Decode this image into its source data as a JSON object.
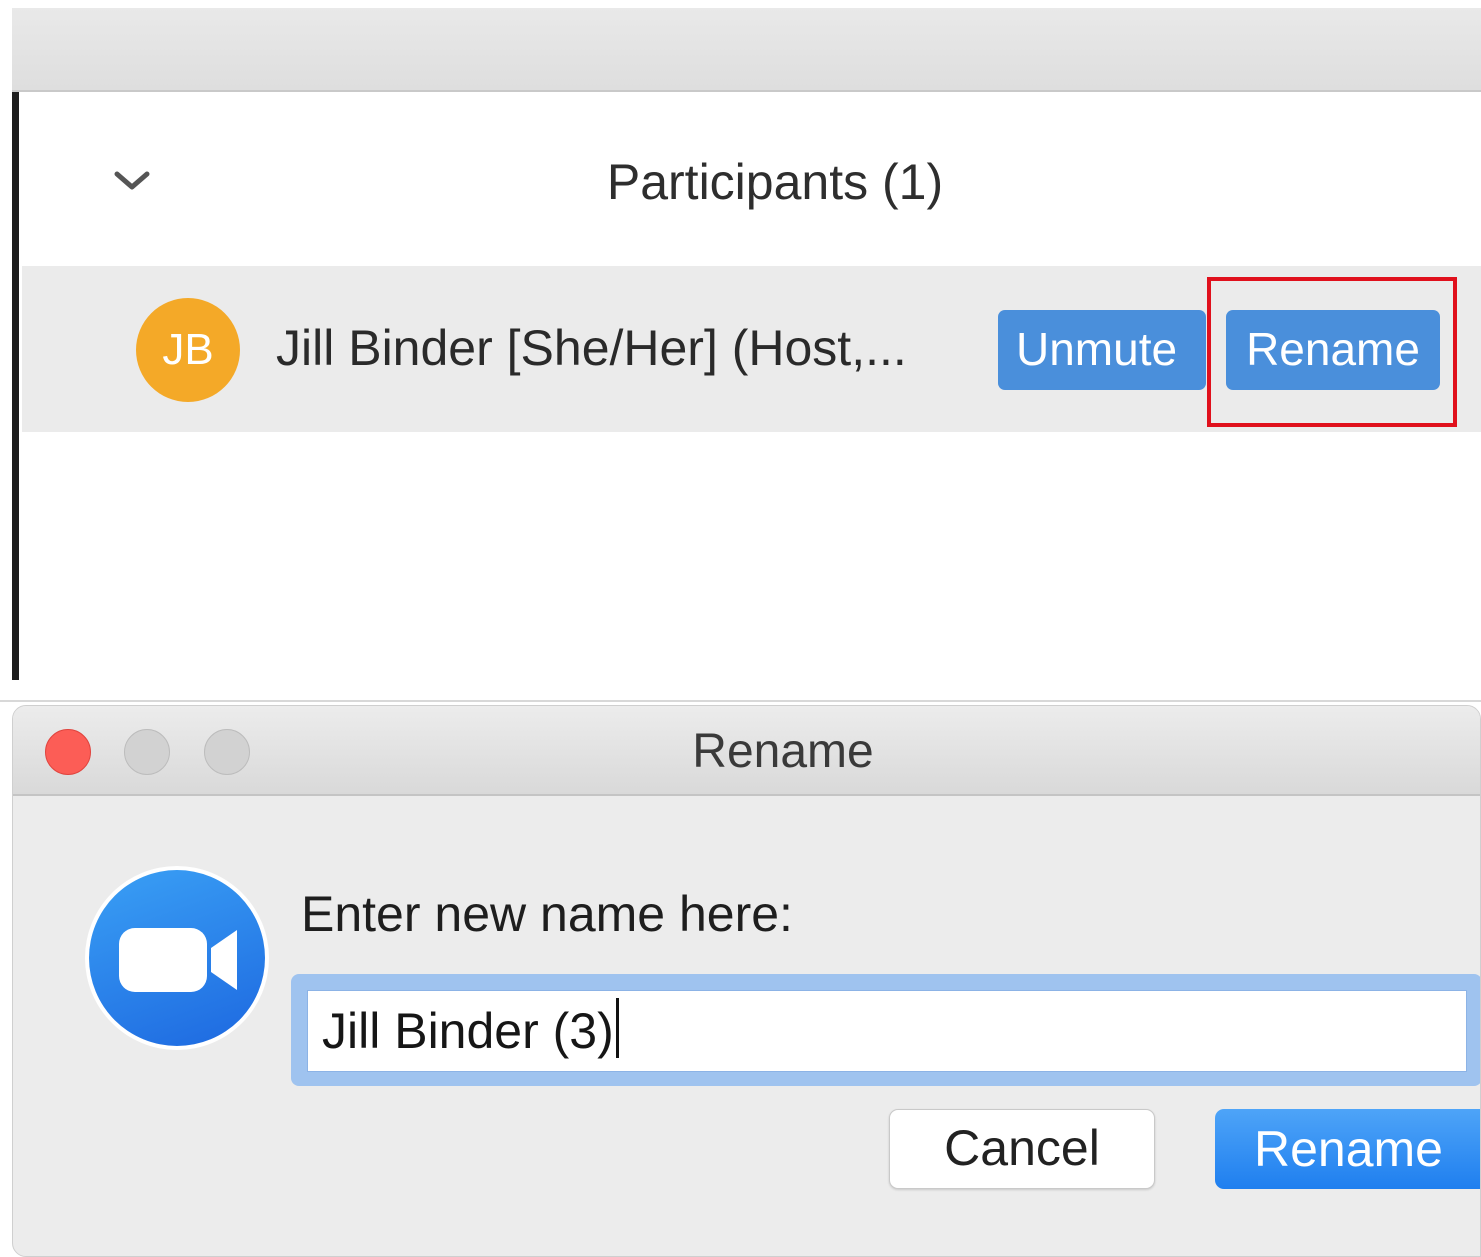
{
  "participants_panel": {
    "title": "Participants (1)",
    "participant": {
      "initials": "JB",
      "name": "Jill Binder [She/Her] (Host,...",
      "avatar_color": "#f4a928",
      "unmute_label": "Unmute",
      "rename_label": "Rename"
    },
    "highlight_color": "#e0101c"
  },
  "rename_dialog": {
    "title": "Rename",
    "prompt": "Enter new name here:",
    "input_value": "Jill Binder (3)",
    "cancel_label": "Cancel",
    "rename_label": "Rename",
    "logo_icon": "zoom-camera-icon"
  },
  "colors": {
    "accent_blue": "#4a8fdb",
    "primary_button": "#1f7fef",
    "window_close": "#fc5d56"
  }
}
